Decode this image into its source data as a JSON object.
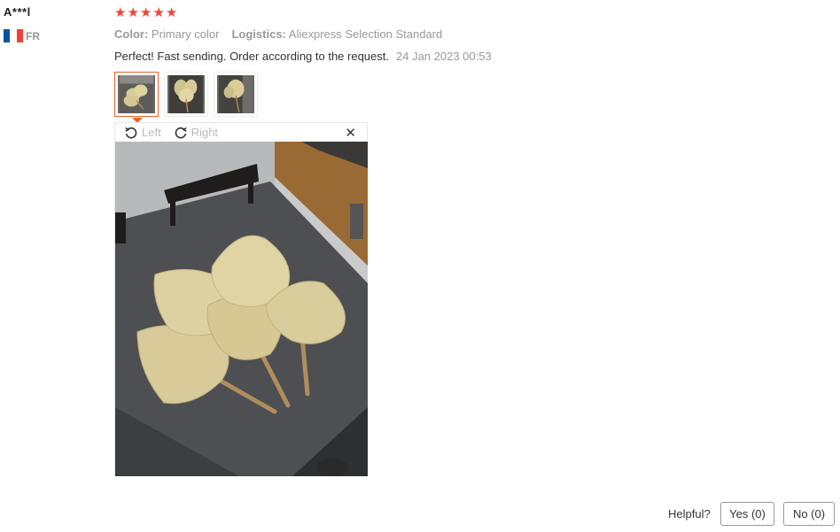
{
  "reviewer": {
    "name": "A***l",
    "country_code": "FR",
    "flag_colors": [
      "#0055a4",
      "#ffffff",
      "#ef4135"
    ]
  },
  "rating": {
    "value": 5,
    "max": 5,
    "star_color": "#f44336"
  },
  "attributes": [
    {
      "key": "Color:",
      "value": "Primary color"
    },
    {
      "key": "Logistics:",
      "value": "Aliexpress Selection Standard"
    }
  ],
  "review": {
    "text": "Perfect! Fast sending. Order according to the request.",
    "date": "24 Jan 2023 00:53"
  },
  "thumbnails": {
    "count": 3,
    "active_index": 0,
    "active_color": "#e8642a"
  },
  "viewer": {
    "rotate_left_label": "Left",
    "rotate_right_label": "Right",
    "close_symbol": "✕",
    "icons": [
      "rotate-left-icon",
      "rotate-right-icon",
      "close-icon"
    ]
  },
  "helpful": {
    "label": "Helpful?",
    "yes_label": "Yes (0)",
    "no_label": "No (0)"
  }
}
